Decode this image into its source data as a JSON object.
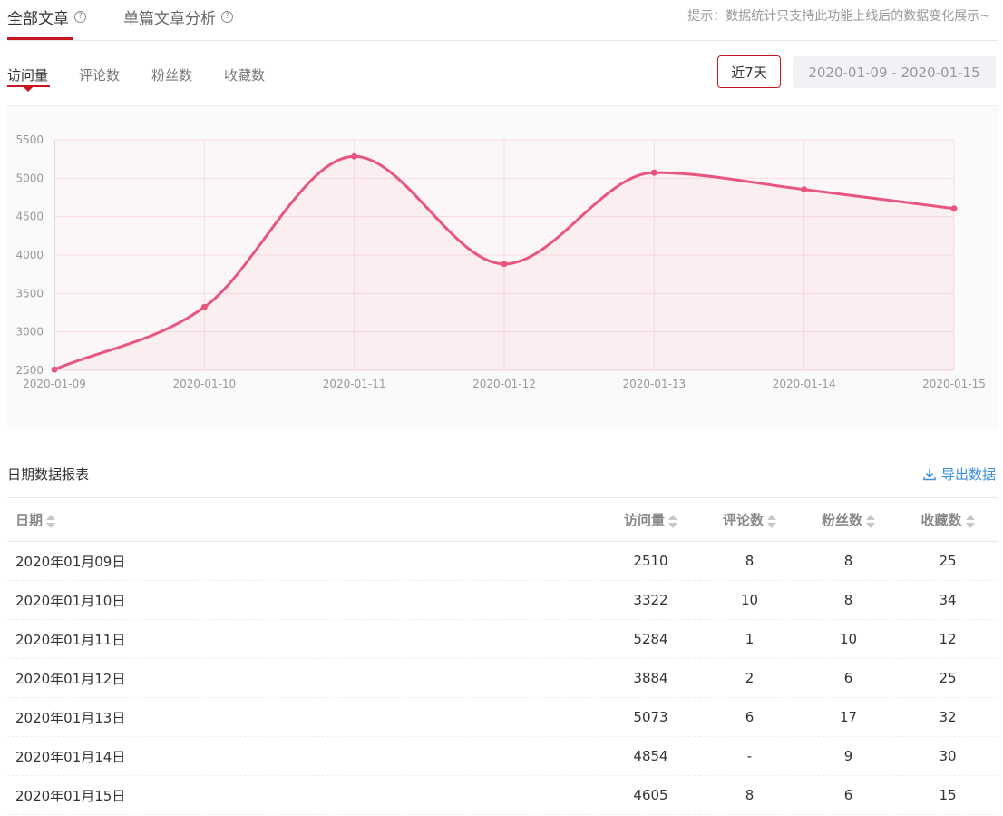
{
  "top_tabs": [
    {
      "label": "全部文章",
      "active": true
    },
    {
      "label": "单篇文章分析",
      "active": false
    }
  ],
  "help_icon": "question-circle-icon",
  "hint": "提示：数据统计只支持此功能上线后的数据变化展示~",
  "metric_tabs": [
    {
      "label": "访问量",
      "active": true
    },
    {
      "label": "评论数",
      "active": false
    },
    {
      "label": "粉丝数",
      "active": false
    },
    {
      "label": "收藏数",
      "active": false
    }
  ],
  "range_button": "近7天",
  "date_range": "2020-01-09 - 2020-01-15",
  "colors": {
    "accent": "#c81623",
    "line": "#e8557f",
    "link": "#3a8ee6"
  },
  "chart_data": {
    "type": "line",
    "title": "",
    "xlabel": "",
    "ylabel": "",
    "categories": [
      "2020-01-09",
      "2020-01-10",
      "2020-01-11",
      "2020-01-12",
      "2020-01-13",
      "2020-01-14",
      "2020-01-15"
    ],
    "series": [
      {
        "values": [
          2510,
          3322,
          5284,
          3884,
          5073,
          4854,
          4605
        ]
      }
    ],
    "ylim": [
      2500,
      5500
    ],
    "yticks": [
      2500,
      3000,
      3500,
      4000,
      4500,
      5000,
      5500
    ],
    "smooth": true,
    "grid": true,
    "legend": "none"
  },
  "report": {
    "title": "日期数据报表",
    "export_label": "导出数据",
    "export_icon": "download-icon",
    "sort_icon": "sort-caret-icon",
    "columns": [
      "日期",
      "访问量",
      "评论数",
      "粉丝数",
      "收藏数"
    ],
    "rows": [
      [
        "2020年01月09日",
        "2510",
        "8",
        "8",
        "25"
      ],
      [
        "2020年01月10日",
        "3322",
        "10",
        "8",
        "34"
      ],
      [
        "2020年01月11日",
        "5284",
        "1",
        "10",
        "12"
      ],
      [
        "2020年01月12日",
        "3884",
        "2",
        "6",
        "25"
      ],
      [
        "2020年01月13日",
        "5073",
        "6",
        "17",
        "32"
      ],
      [
        "2020年01月14日",
        "4854",
        "-",
        "9",
        "30"
      ],
      [
        "2020年01月15日",
        "4605",
        "8",
        "6",
        "15"
      ]
    ]
  }
}
